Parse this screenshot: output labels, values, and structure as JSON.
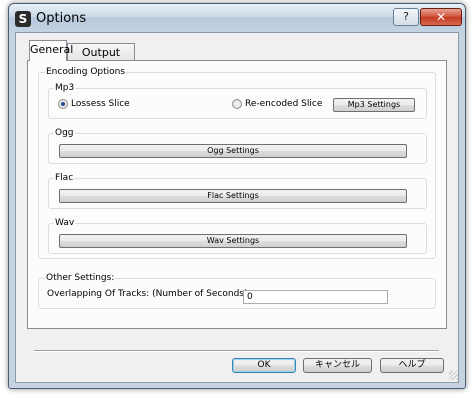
{
  "window": {
    "title": "Options",
    "app_icon_glyph": "S",
    "help_glyph": "?",
    "close_glyph": "✕"
  },
  "tabs": [
    {
      "label": "General",
      "selected": true
    },
    {
      "label": "Output Details",
      "selected": false
    }
  ],
  "encoding_options": {
    "label": "Encoding Options",
    "mp3": {
      "label": "Mp3",
      "radio_lossless": {
        "label": "Lossess Slice",
        "checked": true
      },
      "radio_reencoded": {
        "label": "Re-encoded Slice",
        "checked": false
      },
      "settings_button": "Mp3 Settings"
    },
    "ogg": {
      "label": "Ogg",
      "settings_button": "Ogg Settings"
    },
    "flac": {
      "label": "Flac",
      "settings_button": "Flac Settings"
    },
    "wav": {
      "label": "Wav",
      "settings_button": "Wav Settings"
    }
  },
  "other_settings": {
    "label": "Other Settings:",
    "overlap_label": "Overlapping Of Tracks: (Number of Seconds)",
    "overlap_value": "0"
  },
  "buttons": {
    "ok": "OK",
    "cancel": "キャンセル",
    "help": "ヘルプ"
  },
  "colors": {
    "titlebar": "#c6d3e1",
    "close_button": "#c43820",
    "panel": "#fcfcfc",
    "dialog_bg": "#f0f0f0"
  }
}
